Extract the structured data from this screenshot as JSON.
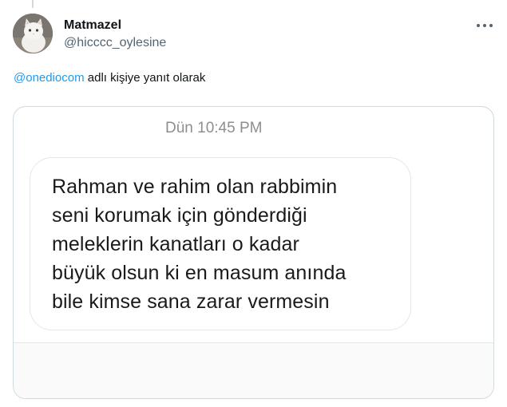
{
  "tweet": {
    "display_name": "Matmazel",
    "handle": "@hicccc_oylesine",
    "reply_mention": "@onediocom",
    "reply_rest": " adlı kişiye yanıt olarak",
    "avatar_icon": "cat-avatar-icon",
    "more_icon": "more-dots-icon"
  },
  "media": {
    "timestamp": "Dün 10:45 PM",
    "message": "Rahman ve rahim olan rabbimin\nseni korumak için gönderdiği\nmeleklerin kanatları o kadar\nbüyük olsun ki en masum anında\nbile kimse sana zarar vermesin"
  },
  "colors": {
    "link": "#1d9bf0",
    "secondary_text": "#536471",
    "border": "#cfd9de"
  }
}
